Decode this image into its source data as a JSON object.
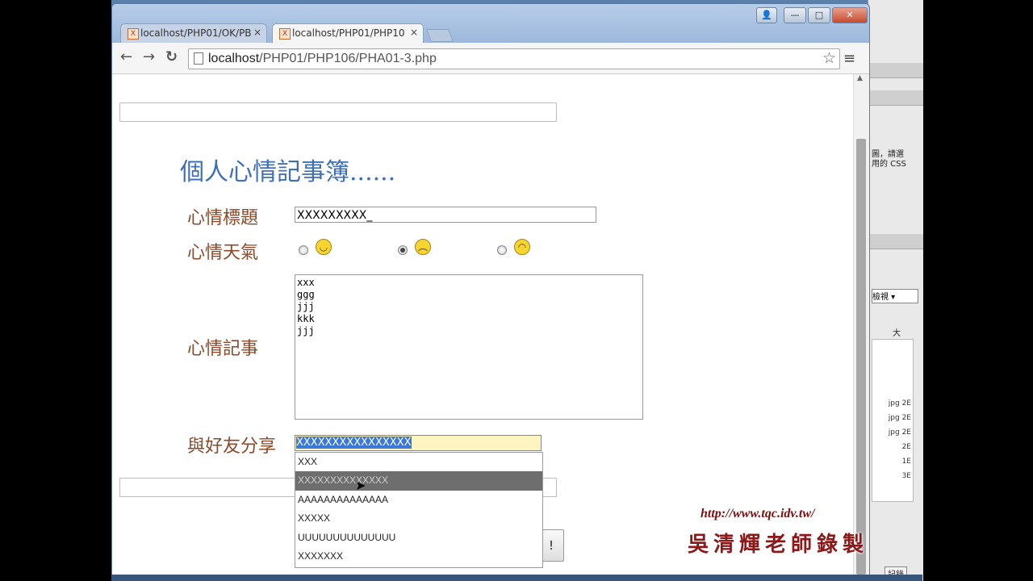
{
  "browser": {
    "tabs": [
      {
        "label": "localhost/PHP01/OK/PB",
        "active": false
      },
      {
        "label": "localhost/PHP01/PHP10",
        "active": true
      }
    ],
    "tab_close": "×",
    "url_host": "localhost",
    "url_path": "/PHP01/PHP106/PHA01-3.php",
    "nav": {
      "back": "←",
      "forward": "→",
      "reload": "C"
    },
    "star": "☆",
    "menu": "≡"
  },
  "page": {
    "heading": "個人心情記事簿......",
    "labels": {
      "title": "心情標題",
      "weather": "心情天氣",
      "notes": "心情記事",
      "share": "與好友分享"
    },
    "title_value": "XXXXXXXXX_",
    "weather_options": [
      {
        "icon": "smile-emoji-icon",
        "checked": false
      },
      {
        "icon": "sad-emoji-icon",
        "checked": true
      },
      {
        "icon": "crying-emoji-icon",
        "checked": false
      }
    ],
    "notes_lines": [
      "xxx",
      "ggg",
      "jjj",
      "kkk",
      "jjj"
    ],
    "share_value": "XXXXXXXXXXXXXXXX",
    "submit_label": "!",
    "autocomplete": [
      "XXX",
      "XXXXXXXXXXXXXX",
      "AAAAAAAAAAAAAA",
      "XXXXX",
      "UUUUUUUUUUUUUU",
      "XXXXXXX"
    ],
    "autocomplete_highlighted": 1
  },
  "background_app": {
    "side_text": "圖，請選\n用的 CSS",
    "dropdown_label": "檢視",
    "column_header": "大",
    "file_sizes": [
      "jpg 2E",
      "jpg 2E",
      "jpg 2E",
      "2E",
      "1E",
      "3E"
    ],
    "record_button": "記錄"
  },
  "overlay": {
    "watermark_url": "http://www.tqc.idv.tw/",
    "recorder": "吳清輝老師錄製"
  }
}
